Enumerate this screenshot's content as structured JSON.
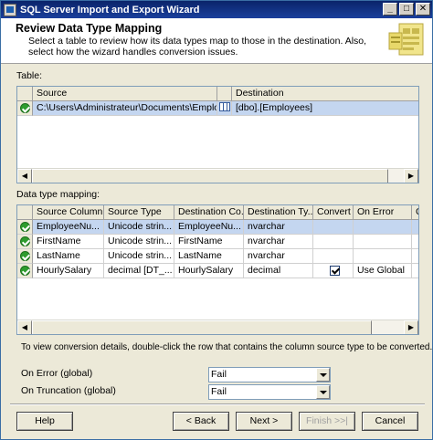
{
  "window": {
    "title": "SQL Server Import and Export Wizard",
    "controls": [
      "_",
      "□",
      "✕"
    ]
  },
  "header": {
    "title": "Review Data Type Mapping",
    "description": "Select a table to review how its data types map to those in the destination. Also, select how the wizard handles conversion issues."
  },
  "table_section": {
    "label": "Table:",
    "columns": [
      "Source",
      "Destination"
    ],
    "rows": [
      {
        "status": "ok",
        "source": "C:\\Users\\Administrateur\\Documents\\Employe...",
        "destination": "[dbo].[Employees]"
      }
    ]
  },
  "mapping_section": {
    "label": "Data type mapping:",
    "columns": [
      "Source Column",
      "Source Type",
      "Destination Co...",
      "Destination Ty...",
      "Convert",
      "On Error",
      "C"
    ],
    "rows": [
      {
        "status": "ok",
        "source_column": "EmployeeNu...",
        "source_type": "Unicode strin...",
        "destination_column": "EmployeeNu...",
        "destination_type": "nvarchar",
        "convert": false,
        "on_error": ""
      },
      {
        "status": "ok",
        "source_column": "FirstName",
        "source_type": "Unicode strin...",
        "destination_column": "FirstName",
        "destination_type": "nvarchar",
        "convert": false,
        "on_error": ""
      },
      {
        "status": "ok",
        "source_column": "LastName",
        "source_type": "Unicode strin...",
        "destination_column": "LastName",
        "destination_type": "nvarchar",
        "convert": false,
        "on_error": ""
      },
      {
        "status": "ok",
        "source_column": "HourlySalary",
        "source_type": "decimal [DT_...",
        "destination_column": "HourlySalary",
        "destination_type": "decimal",
        "convert": true,
        "on_error": "Use Global"
      }
    ]
  },
  "hint": "To view conversion details, double-click the row that contains the column source type to be converted.",
  "on_error": {
    "label": "On Error (global)",
    "value": "Fail"
  },
  "on_truncation": {
    "label": "On Truncation (global)",
    "value": "Fail"
  },
  "buttons": {
    "help": "Help",
    "back": "< Back",
    "next": "Next >",
    "finish": "Finish >>|",
    "cancel": "Cancel"
  },
  "colors": {
    "titlebar": "#0a246a",
    "window_bg": "#ece9d8",
    "selected_row": "#c4d6f0",
    "ok_status": "#2e9c2e"
  },
  "icons": [
    "app-icon",
    "wizard-graphic-icon",
    "status-ok-icon",
    "table-icon",
    "checkbox-icon",
    "dropdown-arrow-icon"
  ]
}
